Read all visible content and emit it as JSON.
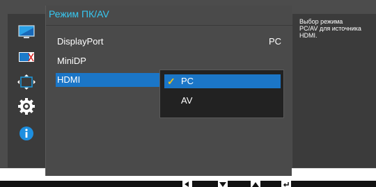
{
  "panel": {
    "title": "Режим ПК/AV",
    "rows": [
      {
        "label": "DisplayPort",
        "value": "PC"
      },
      {
        "label": "MiniDP",
        "value": ""
      },
      {
        "label": "HDMI",
        "value": ""
      }
    ]
  },
  "dropdown": {
    "options": [
      "PC",
      "AV"
    ],
    "selected": "PC"
  },
  "help": {
    "text": "Выбор режима PC/AV для источника HDMI."
  },
  "sidebar": {
    "icons": [
      "picture-icon",
      "color-icon",
      "size-position-icon",
      "settings-gear-icon",
      "info-icon"
    ]
  },
  "colors": {
    "accent": "#37c8f2",
    "highlight": "#1b76c7",
    "check": "#f2c518"
  }
}
